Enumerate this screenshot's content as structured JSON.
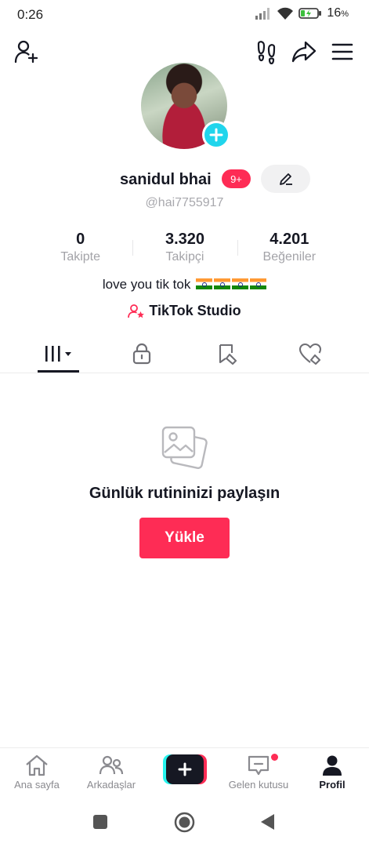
{
  "status_bar": {
    "time": "0:26",
    "battery_percent": "16",
    "battery_unit": "%",
    "icons": [
      "signal-icon",
      "wifi-icon",
      "battery-icon"
    ]
  },
  "top_bar": {
    "icons": [
      "add-friend-icon",
      "footprints-icon",
      "share-icon",
      "menu-icon"
    ]
  },
  "profile": {
    "username": "sanidul bhai",
    "notification_badge": "9+",
    "handle": "@hai7755917",
    "bio_text": "love you tik tok",
    "bio_flags": 4,
    "studio_label": "TikTok Studio"
  },
  "stats": [
    {
      "value": "0",
      "label": "Takipte"
    },
    {
      "value": "3.320",
      "label": "Takipçi"
    },
    {
      "value": "4.201",
      "label": "Beğeniler"
    }
  ],
  "tabs": [
    {
      "icon": "videos-grid-icon",
      "active": true
    },
    {
      "icon": "private-lock-icon",
      "active": false
    },
    {
      "icon": "reposts-icon",
      "active": false
    },
    {
      "icon": "liked-heart-icon",
      "active": false
    }
  ],
  "empty_state": {
    "icon": "photo-stack-icon",
    "title": "Günlük rutininizi paylaşın",
    "upload_button": "Yükle"
  },
  "bottom_nav": {
    "home": "Ana sayfa",
    "friends": "Arkadaşlar",
    "inbox": "Gelen kutusu",
    "profile": "Profil",
    "active": "profile"
  },
  "colors": {
    "accent": "#fe2c55",
    "cyan": "#25f4ee",
    "avatar_plus": "#20d5ec",
    "text": "#161823",
    "muted": "#a3a3a8"
  }
}
